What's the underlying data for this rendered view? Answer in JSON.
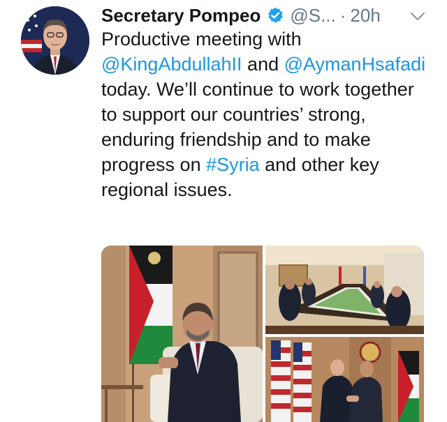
{
  "tweet": {
    "author_name": "Secretary Pompeo",
    "handle": "@S...",
    "separator": "·",
    "time": "20h",
    "text": {
      "part1": "Productive meeting with ",
      "mention1": "@KingAbdullahII",
      "part2": " and ",
      "mention2": "@AymanHsafadi",
      "part3": " today. We’ll continue to work together to support our countries’ strong, enduring friendship and to make progress on ",
      "hashtag": "#Syria",
      "part4": " and other key regional issues."
    },
    "icons": {
      "verified": "verified-badge-icon",
      "menu": "chevron-down-icon"
    },
    "media": [
      {
        "description_name": "photo-king-seated"
      },
      {
        "description_name": "photo-conference-table"
      },
      {
        "description_name": "photo-handshake"
      }
    ]
  },
  "colors": {
    "link": "#1b95e0",
    "secondary_text": "#657786",
    "verified": "#1da1f2",
    "primary_text": "#14171a"
  }
}
